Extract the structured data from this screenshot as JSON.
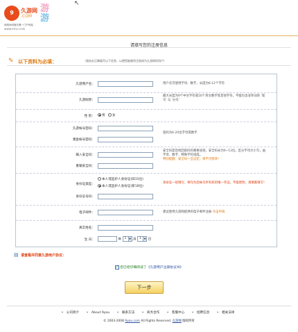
{
  "header": {
    "logo_mark": "9",
    "logo_name": "久游网",
    "logo_com": ".COM",
    "logo_tagline": "网络休闲娱乐第一门户网站",
    "logo_url": "WWW.9YOU.COM",
    "deco_a": "游",
    "deco_b": "游"
  },
  "page_title": "请填写您的注册信息",
  "section": {
    "title": "以下资料为必填：",
    "note": "（请务必正确填写以下信息，以便您能顺利注册成为久游网的用户）"
  },
  "form": {
    "username": {
      "label": "久游用户名：",
      "value": "",
      "hint": "用户名可使用字母、数字，长度为6-12个字符"
    },
    "nickname": {
      "label": "久游昵称：",
      "value": "",
      "hint": "最大长度为9个中文字符或16个英文数字等其他字符，不能包含非单词的 '或号' 与 '分号'"
    },
    "gender": {
      "label": "性  别：",
      "options": [
        "男",
        "女"
      ],
      "selected": "男"
    },
    "password": {
      "label": "久游帐号密码：",
      "value": "",
      "hint": "密码为6-20位字母或数字"
    },
    "password_confirm": {
      "label": "重复帐号密码：",
      "value": ""
    },
    "security_code": {
      "label": "输入安全码：",
      "value": "",
      "hint": "安全码是您找回密码的重要途径，安全码长为6~12位，区分字母大小写，由字母、数字、特殊字符组成。",
      "hint_warning": "特别提醒：安全码一旦设定，将不可修改！"
    },
    "security_code_confirm": {
      "label": "重输安全码：",
      "value": ""
    },
    "id_type": {
      "label": "身份证类型：",
      "options": [
        "本人或监护人身份证(旧15位)",
        "本人或监护人身份证(新18位)"
      ],
      "selected": "本人或监护人身份证(新18位)",
      "hint": "身份证一经填写，将作为您帐号所有权的唯一凭证，不能更改，请慎重填写！"
    },
    "id_number": {
      "label": "身份证号码：",
      "value": ""
    },
    "email": {
      "label": "电子邮件：",
      "value": "",
      "hint": "建议使用久游网提供的电子邮件注册",
      "hint_link": "点击申请"
    },
    "real_name": {
      "label": "真实姓名：",
      "value": ""
    },
    "birthday": {
      "label": "生  日：",
      "year": "",
      "year_unit": "年",
      "month": "1",
      "month_unit": "月",
      "day": "1",
      "day_unit": "日"
    }
  },
  "agreement": {
    "heading": "请查看并同意久游用户协议：",
    "checkbox_checked": true,
    "check_mark": "✓",
    "text": "您已经仔细阅读了",
    "link": "《久游用户注册协议书》"
  },
  "next_button": "下一步",
  "footer": {
    "links": [
      "公司简介",
      "About 9you",
      "联系方法",
      "商务合作",
      "客服中心",
      "招聘信息",
      "相关法律"
    ],
    "copyright_prefix": "© 2003-2008",
    "copyright_link": "9you.com",
    "copyright_suffix": "All Rights Reserved.",
    "copyright_brand": "久游网",
    "copyright_end": "版权所有"
  }
}
